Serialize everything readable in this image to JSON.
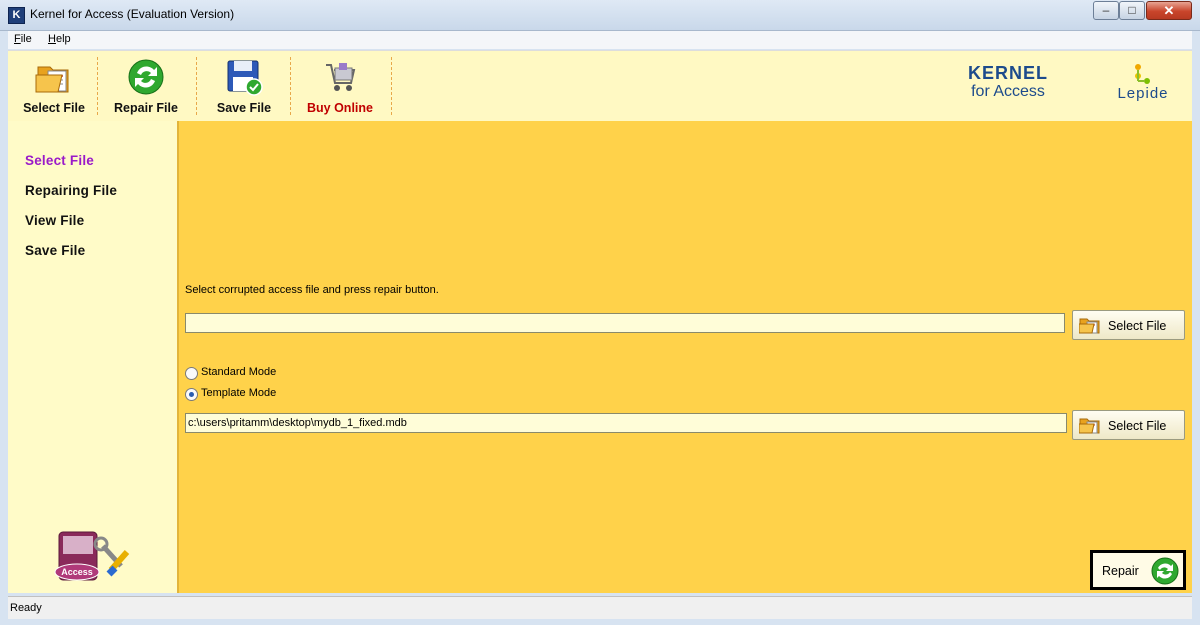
{
  "window": {
    "title": "Kernel for Access (Evaluation Version)",
    "app_icon_letter": "K"
  },
  "menu": {
    "file": "File",
    "help": "Help"
  },
  "toolbar": {
    "select_file": "Select File",
    "repair_file": "Repair File",
    "save_file": "Save File",
    "buy_online": "Buy Online"
  },
  "brand": {
    "kernel_line1": "KERNEL",
    "kernel_line2": "for Access",
    "lepide": "Lepide"
  },
  "sidebar": {
    "items": [
      {
        "label": "Select File",
        "active": true
      },
      {
        "label": "Repairing File",
        "active": false
      },
      {
        "label": "View File",
        "active": false
      },
      {
        "label": "Save File",
        "active": false
      }
    ],
    "logo_label": "Access"
  },
  "main": {
    "instruction": "Select corrupted access file and press repair button.",
    "file_input_value": "",
    "select_file_button": "Select File",
    "modes": [
      {
        "label": "Standard Mode",
        "selected": false
      },
      {
        "label": "Template Mode",
        "selected": true
      }
    ],
    "template_path_value": "c:\\users\\pritamm\\desktop\\mydb_1_fixed.mdb",
    "select_template_button": "Select File",
    "repair_button": "Repair"
  },
  "status": {
    "text": "Ready"
  },
  "colors": {
    "content_bg": "#ffd24a",
    "sidebar_bg": "#fffbc8",
    "toolbar_bg": "#fff9c3",
    "active_nav": "#9a1ac9",
    "buy_online": "#c00000",
    "brand_blue": "#1d4b8c"
  }
}
